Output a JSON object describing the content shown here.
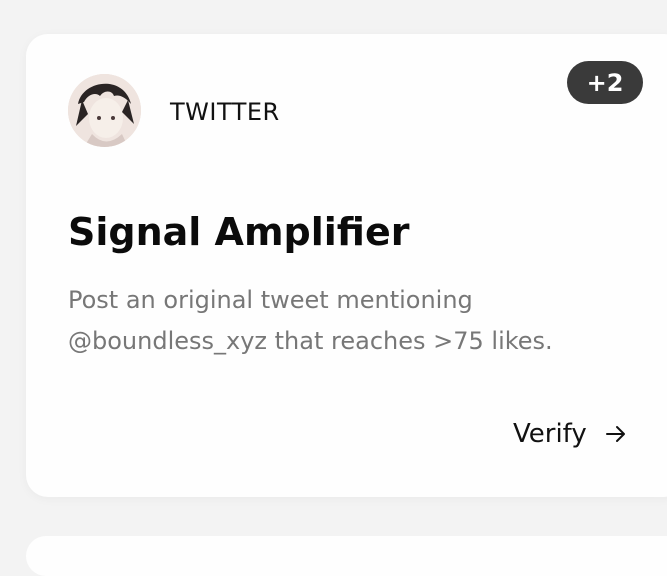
{
  "card": {
    "source_label": "TWITTER",
    "badge": "+2",
    "title": "Signal Amplifier",
    "description": "Post an original tweet mentioning @boundless_xyz that reaches >75 likes.",
    "verify_label": "Verify",
    "avatar_icon": "user-avatar-icon",
    "arrow_icon": "arrow-right-icon"
  },
  "colors": {
    "background": "#f3f3f3",
    "card": "#fefefe",
    "badge": "#3a3a3a",
    "title": "#0b0b0b",
    "description": "#777777"
  }
}
